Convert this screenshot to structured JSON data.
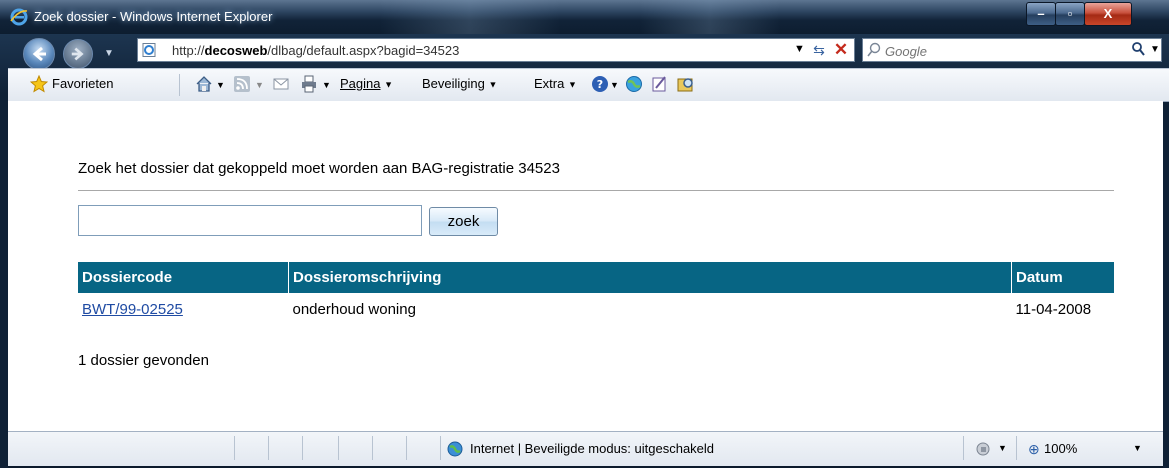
{
  "window": {
    "title": "Zoek dossier - Windows Internet Explorer",
    "min_label": "–",
    "max_label": "▫",
    "close_label": "X"
  },
  "address": {
    "url_prefix": "http://",
    "url_host": "decosweb",
    "url_rest": "/dlbag/default.aspx?bagid=34523"
  },
  "search": {
    "placeholder": "Google"
  },
  "toolbar": {
    "favorites": "Favorieten",
    "page": "Pagina",
    "security": "Beveiliging",
    "extra": "Extra"
  },
  "content": {
    "heading": "Zoek het dossier dat gekoppeld moet worden aan BAG-registratie 34523",
    "search_value": "",
    "search_button": "zoek",
    "columns": [
      "Dossiercode",
      "Dossieromschrijving",
      "Datum"
    ],
    "rows": [
      [
        "BWT/99-02525",
        "onderhoud woning",
        "11-04-2008"
      ]
    ],
    "result_count": "1 dossier gevonden"
  },
  "status": {
    "zone": "Internet | Beveiligde modus: uitgeschakeld",
    "zoom": "100%"
  },
  "colors": {
    "table_header": "#076584",
    "link": "#1f4ba3"
  }
}
